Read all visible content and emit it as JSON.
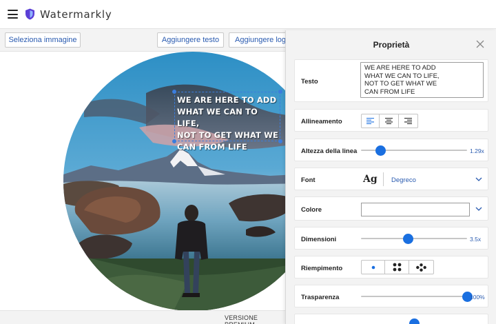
{
  "app": {
    "title": "Watermarkly"
  },
  "toolbar": {
    "select_image": "Seleziona immagine",
    "add_text": "Aggiungere testo",
    "add_logo": "Aggiungere logo"
  },
  "watermark": {
    "text": "WE ARE HERE TO ADD\nWHAT WE CAN TO LIFE,\nNOT TO GET WHAT WE\nCAN FROM LIFE"
  },
  "footer": {
    "label": "VERSIONE PREMIUM"
  },
  "panel": {
    "title": "Proprietà",
    "text": {
      "label": "Testo",
      "value": "WE ARE HERE TO ADD\nWHAT WE CAN TO LIFE,\nNOT TO GET WHAT WE\nCAN FROM LIFE"
    },
    "alignment": {
      "label": "Allineamento",
      "selected": "left"
    },
    "line_height": {
      "label": "Altezza della linea",
      "value": "1.29x",
      "fraction": 0.18
    },
    "font": {
      "label": "Font",
      "preview": "Ag",
      "name": "Degreco"
    },
    "color": {
      "label": "Colore"
    },
    "size": {
      "label": "Dimensioni",
      "value": "3.5x",
      "fraction": 0.44
    },
    "fill": {
      "label": "Riempimento",
      "selected": "single"
    },
    "transparency": {
      "label": "Trasparenza",
      "value": "100%",
      "fraction": 1.0
    }
  },
  "icons": {
    "menu": "hamburger-menu-icon",
    "logo": "shield-logo-icon",
    "close": "close-icon",
    "chevron": "chevron-down-icon"
  },
  "colors": {
    "accent": "#1a6fe0",
    "link": "#2a5bb0",
    "selection": "#3b7ddd"
  }
}
